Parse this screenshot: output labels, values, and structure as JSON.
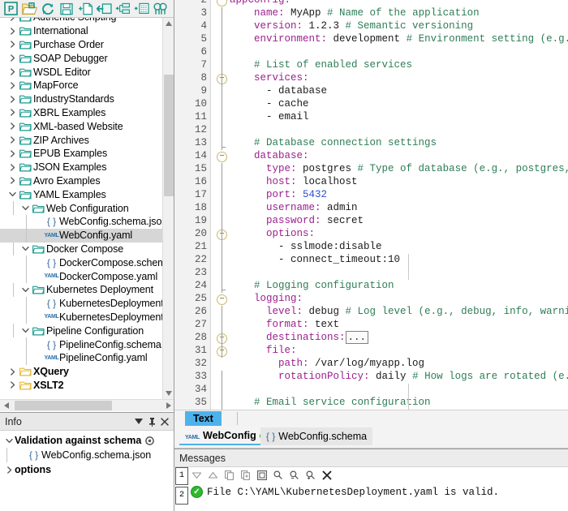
{
  "toolbar": {
    "buttons": [
      {
        "name": "project-icon",
        "label": "P"
      },
      {
        "name": "open-folder-icon",
        "label": "Open"
      },
      {
        "name": "reload-icon",
        "label": "Reload"
      },
      {
        "name": "save-icon",
        "label": "Save"
      },
      {
        "name": "add-file-icon",
        "label": "Add File"
      },
      {
        "name": "add-external-folder-icon",
        "label": "Add External Folder"
      },
      {
        "name": "add-resource-icon",
        "label": "Add Resource"
      },
      {
        "name": "add-url-icon",
        "label": "Add URL"
      },
      {
        "name": "find-icon",
        "label": "Find"
      }
    ]
  },
  "tree": {
    "items": [
      {
        "label": "Authentic Scripting",
        "type": "folder",
        "indent": 0,
        "state": "collapsed",
        "bold": false,
        "clipped": true
      },
      {
        "label": "International",
        "type": "folder",
        "indent": 0,
        "state": "collapsed",
        "bold": false
      },
      {
        "label": "Purchase Order",
        "type": "folder",
        "indent": 0,
        "state": "collapsed",
        "bold": false
      },
      {
        "label": "SOAP Debugger",
        "type": "folder",
        "indent": 0,
        "state": "collapsed",
        "bold": false
      },
      {
        "label": "WSDL Editor",
        "type": "folder",
        "indent": 0,
        "state": "collapsed",
        "bold": false
      },
      {
        "label": "MapForce",
        "type": "folder",
        "indent": 0,
        "state": "collapsed",
        "bold": false
      },
      {
        "label": "IndustryStandards",
        "type": "folder",
        "indent": 0,
        "state": "collapsed",
        "bold": false
      },
      {
        "label": "XBRL Examples",
        "type": "folder",
        "indent": 0,
        "state": "collapsed",
        "bold": false
      },
      {
        "label": "XML-based Website",
        "type": "folder",
        "indent": 0,
        "state": "collapsed",
        "bold": false
      },
      {
        "label": "ZIP Archives",
        "type": "folder",
        "indent": 0,
        "state": "collapsed",
        "bold": false
      },
      {
        "label": "EPUB Examples",
        "type": "folder",
        "indent": 0,
        "state": "collapsed",
        "bold": false
      },
      {
        "label": "JSON Examples",
        "type": "folder",
        "indent": 0,
        "state": "collapsed",
        "bold": false
      },
      {
        "label": "Avro Examples",
        "type": "folder",
        "indent": 0,
        "state": "collapsed",
        "bold": false
      },
      {
        "label": "YAML Examples",
        "type": "folder",
        "indent": 0,
        "state": "expanded",
        "bold": false
      },
      {
        "label": "Web Configuration",
        "type": "folder",
        "indent": 1,
        "state": "expanded",
        "bold": false
      },
      {
        "label": "WebConfig.schema.json",
        "type": "json",
        "indent": 2,
        "state": "none",
        "bold": false,
        "clipped": true
      },
      {
        "label": "WebConfig.yaml",
        "type": "yaml",
        "indent": 2,
        "state": "none",
        "bold": false,
        "selected": true
      },
      {
        "label": "Docker Compose",
        "type": "folder",
        "indent": 1,
        "state": "expanded",
        "bold": false
      },
      {
        "label": "DockerCompose.schema.json",
        "type": "json",
        "indent": 2,
        "state": "none",
        "bold": false,
        "clipped": true
      },
      {
        "label": "DockerCompose.yaml",
        "type": "yaml",
        "indent": 2,
        "state": "none",
        "bold": false
      },
      {
        "label": "Kubernetes Deployment",
        "type": "folder",
        "indent": 1,
        "state": "expanded",
        "bold": false
      },
      {
        "label": "KubernetesDeployment.schema.json",
        "type": "json",
        "indent": 2,
        "state": "none",
        "bold": false,
        "clipped": true
      },
      {
        "label": "KubernetesDeployment.yaml",
        "type": "yaml",
        "indent": 2,
        "state": "none",
        "bold": false,
        "clipped": true
      },
      {
        "label": "Pipeline Configuration",
        "type": "folder",
        "indent": 1,
        "state": "expanded",
        "bold": false
      },
      {
        "label": "PipelineConfig.schema.json",
        "type": "json",
        "indent": 2,
        "state": "none",
        "bold": false,
        "clipped": true
      },
      {
        "label": "PipelineConfig.yaml",
        "type": "yaml",
        "indent": 2,
        "state": "none",
        "bold": false
      },
      {
        "label": "XQuery",
        "type": "folder-yellow",
        "indent": 0,
        "state": "collapsed",
        "bold": true
      },
      {
        "label": "XSLT2",
        "type": "folder-yellow",
        "indent": 0,
        "state": "collapsed",
        "bold": true
      }
    ]
  },
  "info": {
    "title": "Info",
    "buttons": [
      {
        "name": "dropdown-icon"
      },
      {
        "name": "pin-icon"
      },
      {
        "name": "close-icon"
      }
    ],
    "items": [
      {
        "label": "Validation against schema",
        "type": "group",
        "indent": 0,
        "state": "expanded",
        "bold": true,
        "badge": true
      },
      {
        "label": "WebConfig.schema.json",
        "type": "json",
        "indent": 1,
        "state": "none",
        "bold": false
      },
      {
        "label": "options",
        "type": "group",
        "indent": 0,
        "state": "collapsed",
        "bold": true
      }
    ]
  },
  "editor": {
    "first_visible_line": 2,
    "lines": [
      {
        "num": "2",
        "fold": "minus",
        "tokens": [
          {
            "t": "appConfig:",
            "c": "k"
          }
        ]
      },
      {
        "num": "3",
        "tokens": [
          {
            "t": "    ",
            "c": "v"
          },
          {
            "t": "name:",
            "c": "k"
          },
          {
            "t": " MyApp ",
            "c": "v"
          },
          {
            "t": "# Name of the application",
            "c": "c"
          }
        ]
      },
      {
        "num": "4",
        "tokens": [
          {
            "t": "    ",
            "c": "v"
          },
          {
            "t": "version:",
            "c": "k"
          },
          {
            "t": " 1.2.3 ",
            "c": "v"
          },
          {
            "t": "# Semantic versioning",
            "c": "c"
          }
        ]
      },
      {
        "num": "5",
        "tokens": [
          {
            "t": "    ",
            "c": "v"
          },
          {
            "t": "environment:",
            "c": "k"
          },
          {
            "t": " development ",
            "c": "v"
          },
          {
            "t": "# Environment setting (e.g., dev",
            "c": "c"
          }
        ]
      },
      {
        "num": "6",
        "tokens": []
      },
      {
        "num": "7",
        "tokens": [
          {
            "t": "    ",
            "c": "v"
          },
          {
            "t": "# List of enabled services",
            "c": "c"
          }
        ]
      },
      {
        "num": "8",
        "fold": "minus",
        "tokens": [
          {
            "t": "    ",
            "c": "v"
          },
          {
            "t": "services:",
            "c": "k"
          }
        ]
      },
      {
        "num": "9",
        "tokens": [
          {
            "t": "      - ",
            "c": "d"
          },
          {
            "t": "database",
            "c": "v"
          }
        ]
      },
      {
        "num": "10",
        "tokens": [
          {
            "t": "      - ",
            "c": "d"
          },
          {
            "t": "cache",
            "c": "v"
          }
        ]
      },
      {
        "num": "11",
        "tokens": [
          {
            "t": "      - ",
            "c": "d"
          },
          {
            "t": "email",
            "c": "v"
          }
        ]
      },
      {
        "num": "12",
        "tokens": []
      },
      {
        "num": "13",
        "tokens": [
          {
            "t": "    ",
            "c": "v"
          },
          {
            "t": "# Database connection settings",
            "c": "c"
          }
        ]
      },
      {
        "num": "14",
        "fold": "minus",
        "tokens": [
          {
            "t": "    ",
            "c": "v"
          },
          {
            "t": "database:",
            "c": "k"
          }
        ]
      },
      {
        "num": "15",
        "tokens": [
          {
            "t": "      ",
            "c": "v"
          },
          {
            "t": "type:",
            "c": "k"
          },
          {
            "t": " postgres ",
            "c": "v"
          },
          {
            "t": "# Type of database (e.g., postgres, mysq",
            "c": "c"
          }
        ]
      },
      {
        "num": "16",
        "tokens": [
          {
            "t": "      ",
            "c": "v"
          },
          {
            "t": "host:",
            "c": "k"
          },
          {
            "t": " localhost",
            "c": "v"
          }
        ]
      },
      {
        "num": "17",
        "tokens": [
          {
            "t": "      ",
            "c": "v"
          },
          {
            "t": "port:",
            "c": "k"
          },
          {
            "t": " ",
            "c": "v"
          },
          {
            "t": "5432",
            "c": "n"
          }
        ]
      },
      {
        "num": "18",
        "tokens": [
          {
            "t": "      ",
            "c": "v"
          },
          {
            "t": "username:",
            "c": "k"
          },
          {
            "t": " admin",
            "c": "v"
          }
        ]
      },
      {
        "num": "19",
        "tokens": [
          {
            "t": "      ",
            "c": "v"
          },
          {
            "t": "password:",
            "c": "k"
          },
          {
            "t": " secret",
            "c": "v"
          }
        ]
      },
      {
        "num": "20",
        "fold": "minus",
        "tokens": [
          {
            "t": "      ",
            "c": "v"
          },
          {
            "t": "options:",
            "c": "k"
          }
        ]
      },
      {
        "num": "21",
        "tokens": [
          {
            "t": "        - ",
            "c": "d"
          },
          {
            "t": "sslmode:disable",
            "c": "v"
          }
        ]
      },
      {
        "num": "22",
        "tokens": [
          {
            "t": "        - ",
            "c": "d"
          },
          {
            "t": "connect_timeout:10",
            "c": "v"
          }
        ]
      },
      {
        "num": "23",
        "tokens": []
      },
      {
        "num": "24",
        "tokens": [
          {
            "t": "    ",
            "c": "v"
          },
          {
            "t": "# Logging configuration",
            "c": "c"
          }
        ]
      },
      {
        "num": "25",
        "fold": "minus",
        "tokens": [
          {
            "t": "    ",
            "c": "v"
          },
          {
            "t": "logging:",
            "c": "k"
          }
        ]
      },
      {
        "num": "26",
        "tokens": [
          {
            "t": "      ",
            "c": "v"
          },
          {
            "t": "level:",
            "c": "k"
          },
          {
            "t": " debug ",
            "c": "v"
          },
          {
            "t": "# Log level (e.g., debug, info, warning, e",
            "c": "c"
          }
        ]
      },
      {
        "num": "27",
        "tokens": [
          {
            "t": "      ",
            "c": "v"
          },
          {
            "t": "format:",
            "c": "k"
          },
          {
            "t": " text",
            "c": "v"
          }
        ]
      },
      {
        "num": "28",
        "fold": "plus",
        "tokens": [
          {
            "t": "      ",
            "c": "v"
          },
          {
            "t": "destinations:",
            "c": "k"
          },
          {
            "t": "...",
            "c": "collapsed"
          }
        ]
      },
      {
        "num": "31",
        "fold": "minus",
        "tokens": [
          {
            "t": "      ",
            "c": "v"
          },
          {
            "t": "file:",
            "c": "k"
          }
        ]
      },
      {
        "num": "32",
        "tokens": [
          {
            "t": "        ",
            "c": "v"
          },
          {
            "t": "path:",
            "c": "k"
          },
          {
            "t": " /var/log/myapp.log",
            "c": "v"
          }
        ]
      },
      {
        "num": "33",
        "tokens": [
          {
            "t": "        ",
            "c": "v"
          },
          {
            "t": "rotationPolicy:",
            "c": "k"
          },
          {
            "t": " daily ",
            "c": "v"
          },
          {
            "t": "# How logs are rotated (e.g., d",
            "c": "c"
          }
        ]
      },
      {
        "num": "34",
        "tokens": []
      },
      {
        "num": "35",
        "tokens": [
          {
            "t": "    ",
            "c": "v"
          },
          {
            "t": "# Email service configuration",
            "c": "c"
          }
        ]
      }
    ]
  },
  "view_tabs": [
    {
      "label": "Text",
      "active": true
    }
  ],
  "doc_tabs": [
    {
      "label": "WebConfig",
      "icon": "yaml",
      "active": true,
      "modified": true
    },
    {
      "label": "WebConfig.schema",
      "icon": "json",
      "active": false,
      "modified": false
    }
  ],
  "messages": {
    "title": "Messages",
    "side_tabs": [
      "1",
      "2"
    ],
    "toolbar": [
      {
        "name": "next-message-icon"
      },
      {
        "name": "previous-message-icon"
      },
      {
        "name": "copy-icon"
      },
      {
        "name": "copy-with-children-icon"
      },
      {
        "name": "copy-all-icon"
      },
      {
        "name": "find-icon"
      },
      {
        "name": "find-previous-icon"
      },
      {
        "name": "find-next-icon"
      },
      {
        "name": "clear-icon"
      }
    ],
    "entries": [
      {
        "status": "valid",
        "text": "File C:\\YAML\\KubernetesDeployment.yaml is valid."
      }
    ]
  },
  "colors": {
    "accent": "#4db2ec",
    "folder": "#1a9a8e",
    "folder_yellow": "#e8b830",
    "comment": "#2e7d56",
    "key": "#9b1f8e",
    "number": "#2a4fd7",
    "success": "#2eb82e"
  }
}
